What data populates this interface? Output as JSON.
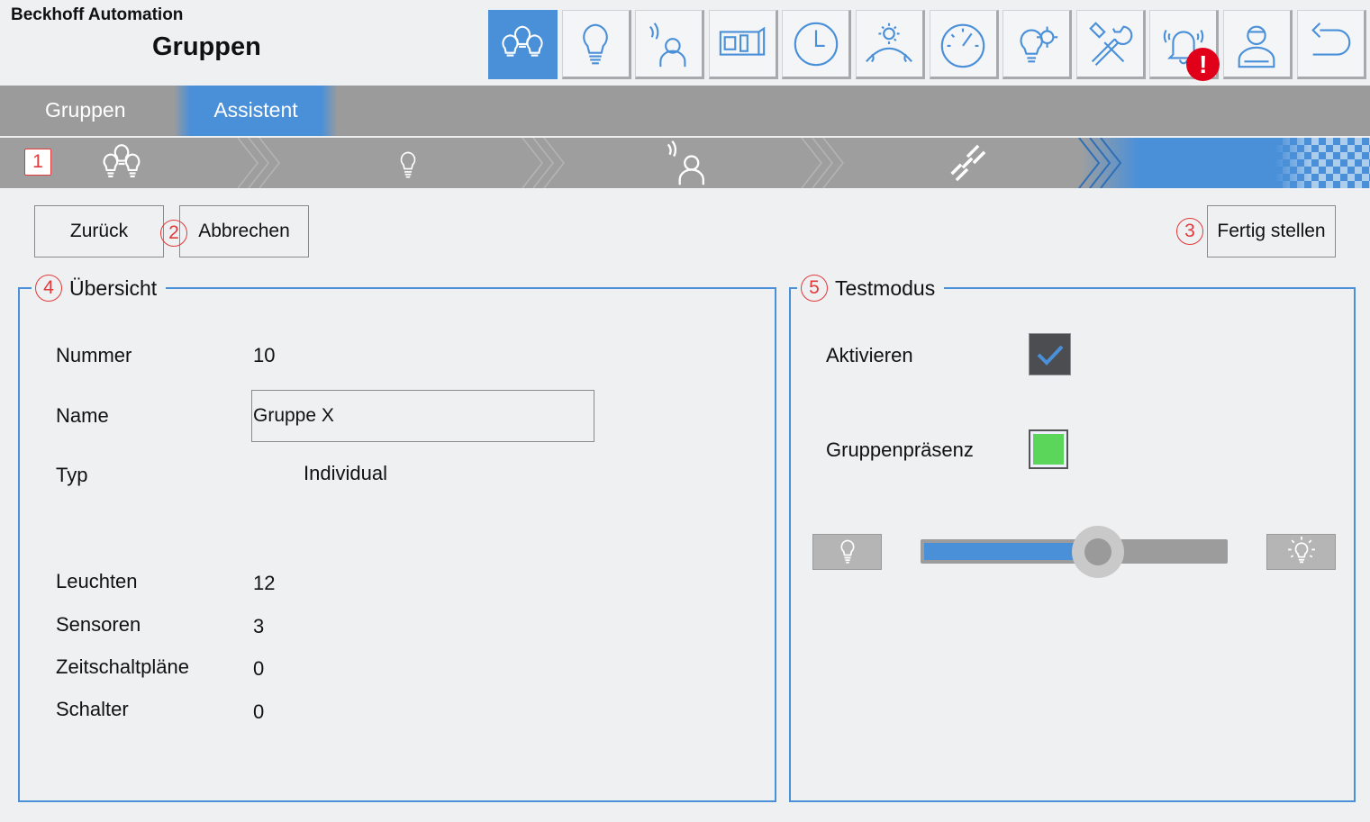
{
  "header": {
    "company": "Beckhoff Automation",
    "title": "Gruppen"
  },
  "toolbar": {
    "buttons": [
      {
        "icon": "groups-icon",
        "active": true
      },
      {
        "icon": "lightbulb-icon",
        "active": false
      },
      {
        "icon": "presence-sensor-icon",
        "active": false
      },
      {
        "icon": "switch-icon",
        "active": false
      },
      {
        "icon": "clock-icon",
        "active": false
      },
      {
        "icon": "daylight-icon",
        "active": false
      },
      {
        "icon": "gauge-icon",
        "active": false
      },
      {
        "icon": "lightbulb-gear-icon",
        "active": false
      },
      {
        "icon": "tools-icon",
        "active": false
      },
      {
        "icon": "alarm-bell-icon",
        "active": false,
        "badge": "!"
      },
      {
        "icon": "user-icon",
        "active": false
      },
      {
        "icon": "back-arrow-icon",
        "active": false
      }
    ]
  },
  "tabs": {
    "gruppen": "Gruppen",
    "assistent": "Assistent"
  },
  "wizard": {
    "steps": [
      "groups-icon",
      "lightbulb-icon",
      "presence-sensor-icon",
      "link-icon"
    ],
    "current_step": 5
  },
  "markers": {
    "m1": "1",
    "m2": "2",
    "m3": "3",
    "m4": "4",
    "m5": "5"
  },
  "actions": {
    "back": "Zurück",
    "cancel": "Abbrechen",
    "finish": "Fertig stellen"
  },
  "overview": {
    "legend": "Übersicht",
    "nummer_label": "Nummer",
    "nummer_value": "10",
    "name_label": "Name",
    "name_value": "Gruppe X",
    "typ_label": "Typ",
    "typ_value": "Individual",
    "leuchten_label": "Leuchten",
    "leuchten_value": "12",
    "sensoren_label": "Sensoren",
    "sensoren_value": "3",
    "zeit_label": "Zeitschaltpläne",
    "zeit_value": "0",
    "schalter_label": "Schalter",
    "schalter_value": "0"
  },
  "testmode": {
    "legend": "Testmodus",
    "activate_label": "Aktivieren",
    "activate_checked": true,
    "presence_label": "Gruppenpräsenz",
    "presence_color": "#5bd65b",
    "dimmer_fraction": 0.58
  },
  "colors": {
    "accent": "#4a90d9",
    "alert": "#e0001a",
    "marker": "#e23a3a"
  }
}
